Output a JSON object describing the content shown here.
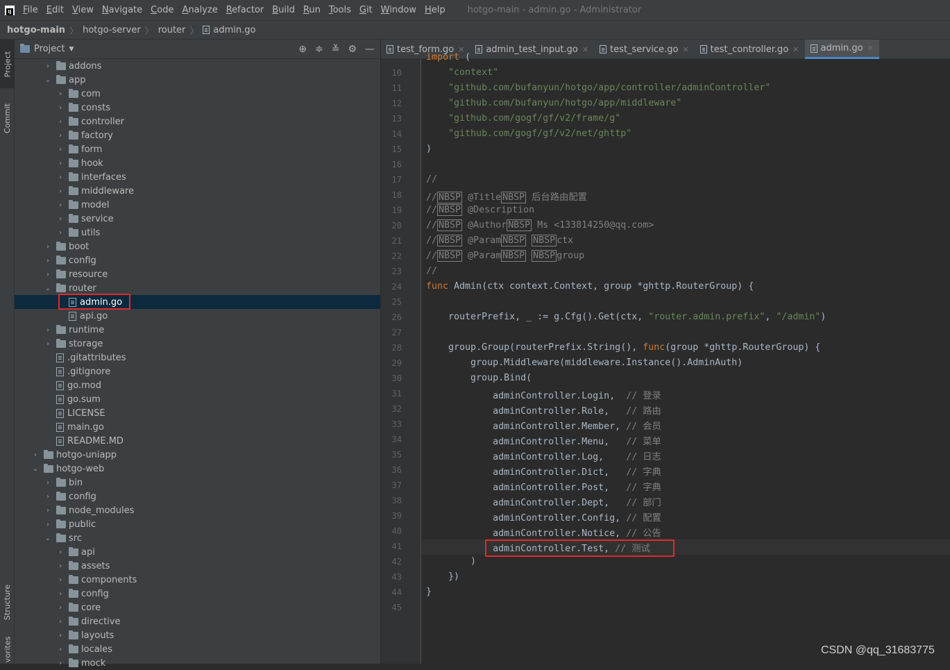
{
  "menubar": {
    "items": [
      "File",
      "Edit",
      "View",
      "Navigate",
      "Code",
      "Analyze",
      "Refactor",
      "Build",
      "Run",
      "Tools",
      "Git",
      "Window",
      "Help"
    ],
    "title": "hotgo-main - admin.go - Administrator"
  },
  "breadcrumb": [
    "hotgo-main",
    "hotgo-server",
    "router",
    "admin.go"
  ],
  "left_strip": [
    "Project",
    "Commit",
    "Structure",
    "vorites"
  ],
  "project_panel": {
    "title": "Project"
  },
  "tree": [
    {
      "label": "addons",
      "type": "folder",
      "depth": 2,
      "arrow": "›"
    },
    {
      "label": "app",
      "type": "folder",
      "depth": 2,
      "arrow": "⌄"
    },
    {
      "label": "com",
      "type": "folder",
      "depth": 3,
      "arrow": "›"
    },
    {
      "label": "consts",
      "type": "folder",
      "depth": 3,
      "arrow": "›"
    },
    {
      "label": "controller",
      "type": "folder",
      "depth": 3,
      "arrow": "›"
    },
    {
      "label": "factory",
      "type": "folder",
      "depth": 3,
      "arrow": "›"
    },
    {
      "label": "form",
      "type": "folder",
      "depth": 3,
      "arrow": "›"
    },
    {
      "label": "hook",
      "type": "folder",
      "depth": 3,
      "arrow": "›"
    },
    {
      "label": "interfaces",
      "type": "folder",
      "depth": 3,
      "arrow": "›"
    },
    {
      "label": "middleware",
      "type": "folder",
      "depth": 3,
      "arrow": "›"
    },
    {
      "label": "model",
      "type": "folder",
      "depth": 3,
      "arrow": "›"
    },
    {
      "label": "service",
      "type": "folder",
      "depth": 3,
      "arrow": "›"
    },
    {
      "label": "utils",
      "type": "folder",
      "depth": 3,
      "arrow": "›"
    },
    {
      "label": "boot",
      "type": "folder",
      "depth": 2,
      "arrow": "›"
    },
    {
      "label": "config",
      "type": "folder",
      "depth": 2,
      "arrow": "›"
    },
    {
      "label": "resource",
      "type": "folder",
      "depth": 2,
      "arrow": "›"
    },
    {
      "label": "router",
      "type": "folder",
      "depth": 2,
      "arrow": "⌄"
    },
    {
      "label": "admin.go",
      "type": "file",
      "depth": 3,
      "arrow": "",
      "selected": true
    },
    {
      "label": "api.go",
      "type": "file",
      "depth": 3,
      "arrow": ""
    },
    {
      "label": "runtime",
      "type": "folder",
      "depth": 2,
      "arrow": "›"
    },
    {
      "label": "storage",
      "type": "folder",
      "depth": 2,
      "arrow": "›"
    },
    {
      "label": ".gitattributes",
      "type": "file",
      "depth": 2,
      "arrow": ""
    },
    {
      "label": ".gitignore",
      "type": "file",
      "depth": 2,
      "arrow": ""
    },
    {
      "label": "go.mod",
      "type": "file",
      "depth": 2,
      "arrow": ""
    },
    {
      "label": "go.sum",
      "type": "file",
      "depth": 2,
      "arrow": ""
    },
    {
      "label": "LICENSE",
      "type": "file",
      "depth": 2,
      "arrow": ""
    },
    {
      "label": "main.go",
      "type": "file",
      "depth": 2,
      "arrow": ""
    },
    {
      "label": "README.MD",
      "type": "file",
      "depth": 2,
      "arrow": ""
    },
    {
      "label": "hotgo-uniapp",
      "type": "folder",
      "depth": 1,
      "arrow": "›"
    },
    {
      "label": "hotgo-web",
      "type": "folder",
      "depth": 1,
      "arrow": "⌄"
    },
    {
      "label": "bin",
      "type": "folder",
      "depth": 2,
      "arrow": "›"
    },
    {
      "label": "config",
      "type": "folder",
      "depth": 2,
      "arrow": "›"
    },
    {
      "label": "node_modules",
      "type": "folder",
      "depth": 2,
      "arrow": "›"
    },
    {
      "label": "public",
      "type": "folder",
      "depth": 2,
      "arrow": "›"
    },
    {
      "label": "src",
      "type": "folder",
      "depth": 2,
      "arrow": "⌄"
    },
    {
      "label": "api",
      "type": "folder",
      "depth": 3,
      "arrow": "›"
    },
    {
      "label": "assets",
      "type": "folder",
      "depth": 3,
      "arrow": "›"
    },
    {
      "label": "components",
      "type": "folder",
      "depth": 3,
      "arrow": "›"
    },
    {
      "label": "config",
      "type": "folder",
      "depth": 3,
      "arrow": "›"
    },
    {
      "label": "core",
      "type": "folder",
      "depth": 3,
      "arrow": "›"
    },
    {
      "label": "directive",
      "type": "folder",
      "depth": 3,
      "arrow": "›"
    },
    {
      "label": "layouts",
      "type": "folder",
      "depth": 3,
      "arrow": "›"
    },
    {
      "label": "locales",
      "type": "folder",
      "depth": 3,
      "arrow": "›"
    },
    {
      "label": "mock",
      "type": "folder",
      "depth": 3,
      "arrow": "›"
    }
  ],
  "tabs": [
    {
      "label": "test_form.go",
      "active": false
    },
    {
      "label": "admin_test_input.go",
      "active": false
    },
    {
      "label": "test_service.go",
      "active": false
    },
    {
      "label": "test_controller.go",
      "active": false
    },
    {
      "label": "admin.go",
      "active": true
    }
  ],
  "code_lines": [
    {
      "n": "",
      "html": "<span class=\"kw\">import</span> ("
    },
    {
      "n": "10",
      "html": "    <span class=\"str\">\"context\"</span>"
    },
    {
      "n": "11",
      "html": "    <span class=\"str\">\"github.com/bufanyun/hotgo/app/controller/adminController\"</span>"
    },
    {
      "n": "12",
      "html": "    <span class=\"str\">\"github.com/bufanyun/hotgo/app/middleware\"</span>"
    },
    {
      "n": "13",
      "html": "    <span class=\"str\">\"github.com/gogf/gf/v2/frame/g\"</span>"
    },
    {
      "n": "14",
      "html": "    <span class=\"str\">\"github.com/gogf/gf/v2/net/ghttp\"</span>"
    },
    {
      "n": "15",
      "html": ")"
    },
    {
      "n": "16",
      "html": ""
    },
    {
      "n": "17",
      "html": "<span class=\"cmt\">//</span>"
    },
    {
      "n": "18",
      "html": "<span class=\"cmt\">//<span class=\"nbsp\">NBSP</span> @Title<span class=\"nbsp\">NBSP</span> 后台路由配置</span>"
    },
    {
      "n": "19",
      "html": "<span class=\"cmt\">//<span class=\"nbsp\">NBSP</span> @Description</span>"
    },
    {
      "n": "20",
      "html": "<span class=\"cmt\">//<span class=\"nbsp\">NBSP</span> @Author<span class=\"nbsp\">NBSP</span> Ms &lt;133814250@qq.com&gt;</span>"
    },
    {
      "n": "21",
      "html": "<span class=\"cmt\">//<span class=\"nbsp\">NBSP</span> @Param<span class=\"nbsp\">NBSP</span> <span class=\"nbsp\">NBSP</span>ctx</span>"
    },
    {
      "n": "22",
      "html": "<span class=\"cmt\">//<span class=\"nbsp\">NBSP</span> @Param<span class=\"nbsp\">NBSP</span> <span class=\"nbsp\">NBSP</span>group</span>"
    },
    {
      "n": "23",
      "html": "<span class=\"cmt\">//</span>"
    },
    {
      "n": "24",
      "html": "<span class=\"kw\">func</span> Admin(ctx context.Context, group *ghttp.RouterGroup) {"
    },
    {
      "n": "25",
      "html": ""
    },
    {
      "n": "26",
      "html": "    routerPrefix, _ := g.Cfg().Get(ctx, <span class=\"str\">\"router.admin.prefix\"</span>, <span class=\"str\">\"/admin\"</span>)"
    },
    {
      "n": "27",
      "html": ""
    },
    {
      "n": "28",
      "html": "    group.Group(routerPrefix.String(), <span class=\"kw\">func</span>(group *ghttp.RouterGroup) {"
    },
    {
      "n": "29",
      "html": "        group.Middleware(middleware.Instance().AdminAuth)"
    },
    {
      "n": "30",
      "html": "        group.Bind("
    },
    {
      "n": "31",
      "html": "            adminController.Login,  <span class=\"cmt\">// 登录</span>"
    },
    {
      "n": "32",
      "html": "            adminController.Role,   <span class=\"cmt\">// 路由</span>"
    },
    {
      "n": "33",
      "html": "            adminController.Member, <span class=\"cmt\">// 会员</span>"
    },
    {
      "n": "34",
      "html": "            adminController.Menu,   <span class=\"cmt\">// 菜单</span>"
    },
    {
      "n": "35",
      "html": "            adminController.Log,    <span class=\"cmt\">// 日志</span>"
    },
    {
      "n": "36",
      "html": "            adminController.Dict,   <span class=\"cmt\">// 字典</span>"
    },
    {
      "n": "37",
      "html": "            adminController.Post,   <span class=\"cmt\">// 字典</span>"
    },
    {
      "n": "38",
      "html": "            adminController.Dept,   <span class=\"cmt\">// 部门</span>"
    },
    {
      "n": "39",
      "html": "            adminController.Config, <span class=\"cmt\">// 配置</span>"
    },
    {
      "n": "40",
      "html": "            adminController.Notice, <span class=\"cmt\">// 公告</span>"
    },
    {
      "n": "41",
      "html": "            adminController.Test, <span class=\"cmt\">// 测试</span>",
      "current": true
    },
    {
      "n": "42",
      "html": "        )"
    },
    {
      "n": "43",
      "html": "    })"
    },
    {
      "n": "44",
      "html": "}"
    },
    {
      "n": "45",
      "html": ""
    }
  ],
  "watermark": "CSDN @qq_31683775",
  "colors": {
    "selection": "#0d293e",
    "highlight_box": "#e02b2b",
    "keyword": "#cc7832",
    "string": "#6a8759",
    "comment": "#808080"
  }
}
